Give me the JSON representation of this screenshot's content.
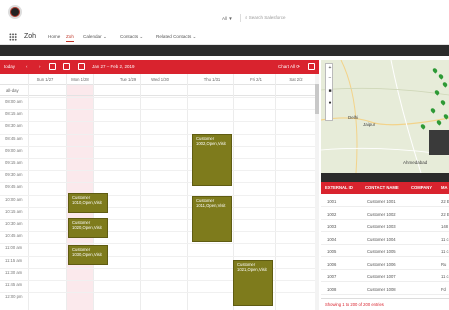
{
  "header": {
    "dropdown": "All ▼",
    "search_placeholder": "Search Salesforce",
    "app_name": "Zoh",
    "nav": [
      "Home",
      "Zoh",
      "Calendar",
      "Contacts",
      "Related Contacts"
    ]
  },
  "toolbar": {
    "today": "today",
    "prev": "‹",
    "next": "›",
    "range": "Jan 27 – Feb 2, 2019",
    "right_label": "Chart All ⟳"
  },
  "calendar": {
    "days": [
      "Sun 1/27",
      "Mon 1/28",
      "Tue 1/29",
      "Wed 1/30",
      "Thu 1/31",
      "Fri 2/1",
      "Sat 2/2"
    ],
    "allday": "all-day",
    "times": [
      "08:00 am",
      "08:15 am",
      "08:30 am",
      "08:45 am",
      "09:00 am",
      "09:15 am",
      "09:30 am",
      "09:45 am",
      "10:00 am",
      "10:15 am",
      "10:30 am",
      "10:45 am",
      "11:00 am",
      "11:15 am",
      "11:30 am",
      "11:45 am",
      "12:00 pm"
    ],
    "events": [
      {
        "line1": "Customer",
        "line2": "1002,Open,Visit"
      },
      {
        "line1": "Customer",
        "line2": "1010,Open,Visit"
      },
      {
        "line1": "Customer",
        "line2": "1011,Open,Visit"
      },
      {
        "line1": "Customer",
        "line2": "1020,Open,Visit"
      },
      {
        "line1": "Customer",
        "line2": "1030,Open,Visit"
      },
      {
        "line1": "Customer",
        "line2": "1021,Open,Visit"
      }
    ]
  },
  "map": {
    "labels": [
      "Delhi",
      "Jaipur",
      "Lucknow",
      "Ahmedabad"
    ],
    "controls": [
      "+",
      "−",
      "■",
      "●"
    ]
  },
  "table": {
    "columns": [
      "EXTERNAL ID",
      "CONTACT NAME",
      "COMPANY",
      "MA"
    ],
    "rows": [
      {
        "id": "1001",
        "name": "Customer 1001",
        "extra": "22 E"
      },
      {
        "id": "1002",
        "name": "Customer 1002",
        "extra": "22 E"
      },
      {
        "id": "1003",
        "name": "Customer 1003",
        "extra": "148"
      },
      {
        "id": "1004",
        "name": "Customer 1004",
        "extra": "11 c"
      },
      {
        "id": "1005",
        "name": "Customer 1005",
        "extra": "11 c"
      },
      {
        "id": "1006",
        "name": "Customer 1006",
        "extra": "Ru"
      },
      {
        "id": "1007",
        "name": "Customer 1007",
        "extra": "11 c"
      },
      {
        "id": "1008",
        "name": "Customer 1008",
        "extra": "Fd"
      }
    ],
    "footer": "Showing 1 to 200 of 200 entries"
  }
}
